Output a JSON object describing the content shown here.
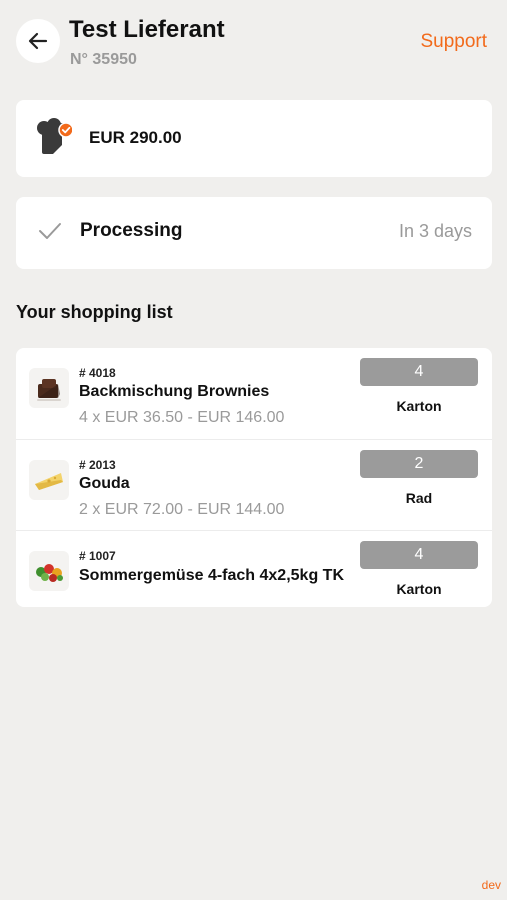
{
  "header": {
    "title": "Test Lieferant",
    "subtitle": "N° 35950",
    "support_label": "Support",
    "back_icon": "arrow-left-icon"
  },
  "total": {
    "amount": "EUR 290.00",
    "icon": "chef-hat-verified-icon"
  },
  "status": {
    "label": "Processing",
    "when": "In 3 days",
    "icon": "check-icon"
  },
  "shopping_list": {
    "title": "Your shopping list",
    "items": [
      {
        "number": "# 4018",
        "name": "Backmischung Brownies",
        "price": "4 x EUR 36.50 - EUR 146.00",
        "qty": "4",
        "unit": "Karton",
        "thumb": "brownie-thumbnail"
      },
      {
        "number": "# 2013",
        "name": "Gouda",
        "price": "2 x EUR 72.00 - EUR 144.00",
        "qty": "2",
        "unit": "Rad",
        "thumb": "cheese-thumbnail"
      },
      {
        "number": "# 1007",
        "name": "Sommergemüse 4-fach 4x2,5kg TK",
        "price": "",
        "qty": "4",
        "unit": "Karton",
        "thumb": "vegetables-thumbnail"
      }
    ]
  },
  "env_label": "dev",
  "colors": {
    "accent": "#f26a1b",
    "background": "#f0efed",
    "badge": "#9b9b9b",
    "muted_text": "#9a9a9a"
  }
}
